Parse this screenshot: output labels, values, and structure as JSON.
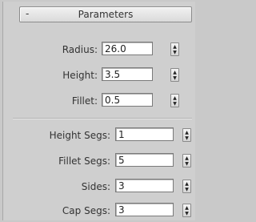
{
  "rollout": {
    "toggle": "-",
    "title": "Parameters"
  },
  "params": [
    {
      "label": "Radius:",
      "value": "26.0"
    },
    {
      "label": "Height:",
      "value": "3.5"
    },
    {
      "label": "Fillet:",
      "value": "0.5"
    }
  ],
  "segments": [
    {
      "label": "Height Segs:",
      "value": "1"
    },
    {
      "label": "Fillet Segs:",
      "value": "5"
    },
    {
      "label": "Sides:",
      "value": "3"
    },
    {
      "label": "Cap Segs:",
      "value": "3"
    }
  ]
}
